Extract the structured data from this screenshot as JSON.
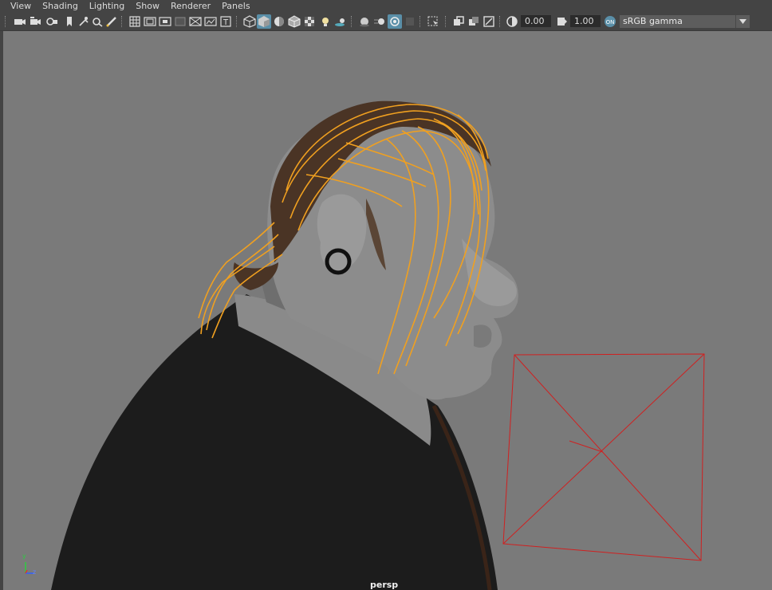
{
  "menu": {
    "items": [
      "View",
      "Shading",
      "Lighting",
      "Show",
      "Renderer",
      "Panels"
    ]
  },
  "toolbar": {
    "exposure_value": "0.00",
    "gamma_value": "1.00",
    "color_space": "sRGB gamma",
    "accent": "#5a8fa8"
  },
  "viewport": {
    "camera_label": "persp",
    "axis_labels": {
      "y": "y",
      "z": "z"
    },
    "colors": {
      "background": "#7a7a7a",
      "hair_guides": "#f0a020",
      "camera_frustum": "#d02020"
    }
  }
}
